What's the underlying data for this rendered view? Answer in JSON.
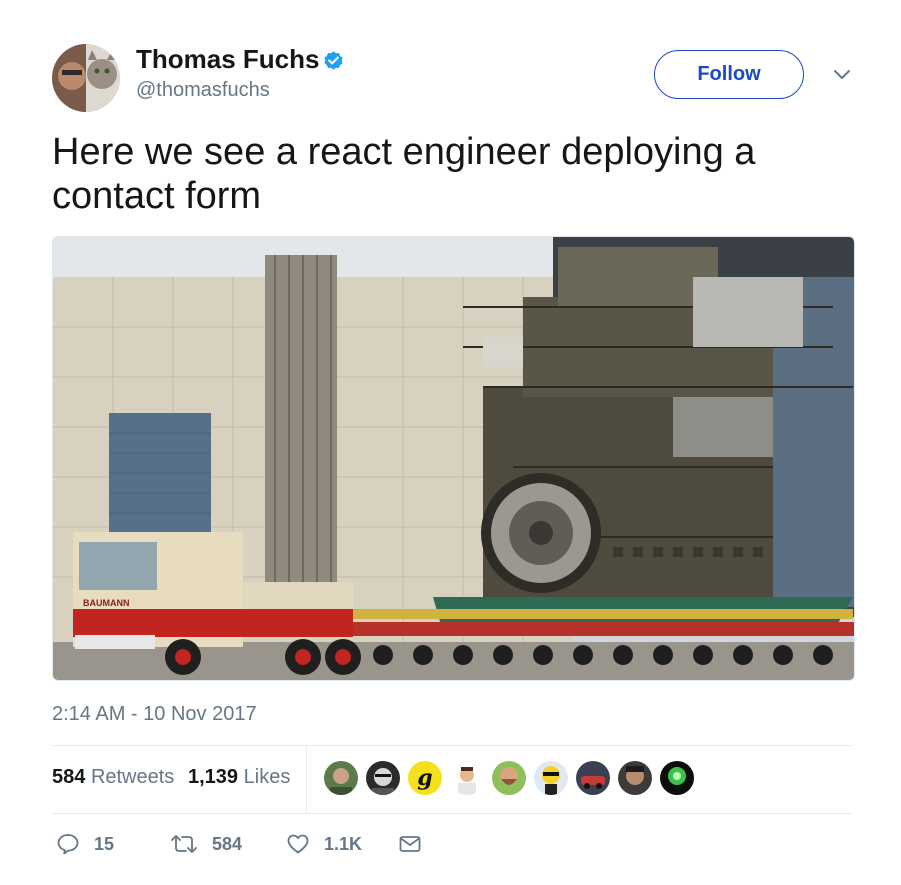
{
  "author": {
    "name": "Thomas Fuchs",
    "handle": "@thomasfuchs",
    "verified": true
  },
  "follow_label": "Follow",
  "tweet_text": "Here we see a react engineer deploying a contact form",
  "media_text": {
    "truck_brand": "BAUMANN"
  },
  "timestamp": "2:14 AM - 10 Nov 2017",
  "stats": {
    "retweets_count": "584",
    "retweets_label": "Retweets",
    "likes_count": "1,139",
    "likes_label": "Likes"
  },
  "likers": [
    {
      "icon": "avatar-man-green"
    },
    {
      "icon": "avatar-man-glasses"
    },
    {
      "icon": "avatar-letter-g",
      "glyph": "g"
    },
    {
      "icon": "avatar-man-cartoon"
    },
    {
      "icon": "avatar-man-beard"
    },
    {
      "icon": "avatar-cartoon-yellow"
    },
    {
      "icon": "avatar-car"
    },
    {
      "icon": "avatar-man-dark"
    },
    {
      "icon": "avatar-green-glow"
    }
  ],
  "actions": {
    "reply_count": "15",
    "retweet_count": "584",
    "like_count": "1.1K"
  },
  "colors": {
    "accent": "#1b4ac4",
    "verified": "#1da1f2",
    "muted": "#657786",
    "text": "#14171a"
  }
}
